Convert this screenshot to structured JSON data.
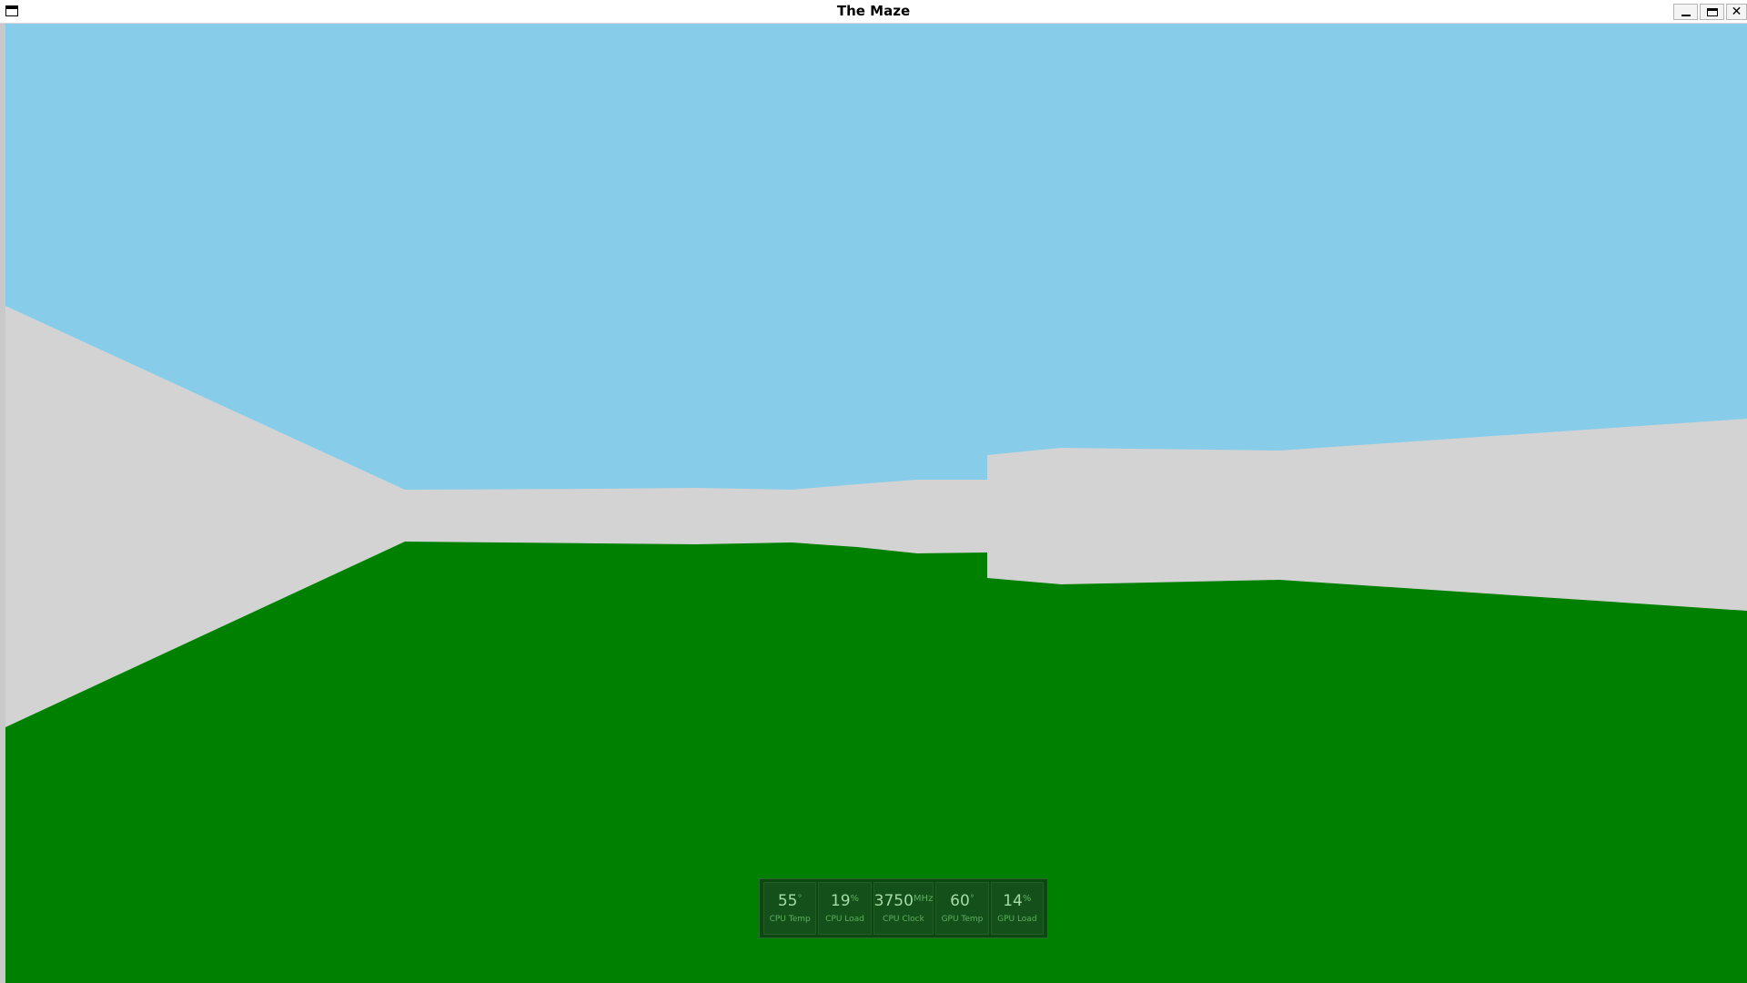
{
  "window": {
    "title": "The Maze",
    "minimize_glyph": "_",
    "maximize_glyph": "□",
    "close_glyph": "✕"
  },
  "scene": {
    "sky_color": "#87cdea",
    "wall_color": "#d3d3d3",
    "floor_color": "#008000"
  },
  "hud": {
    "gauges": [
      {
        "value": "55",
        "unit": "°",
        "label": "CPU Temp"
      },
      {
        "value": "19",
        "unit": "%",
        "label": "CPU Load"
      },
      {
        "value": "3750",
        "unit": "MHz",
        "label": "CPU Clock"
      },
      {
        "value": "60",
        "unit": "°",
        "label": "GPU Temp"
      },
      {
        "value": "14",
        "unit": "%",
        "label": "GPU Load"
      }
    ]
  }
}
